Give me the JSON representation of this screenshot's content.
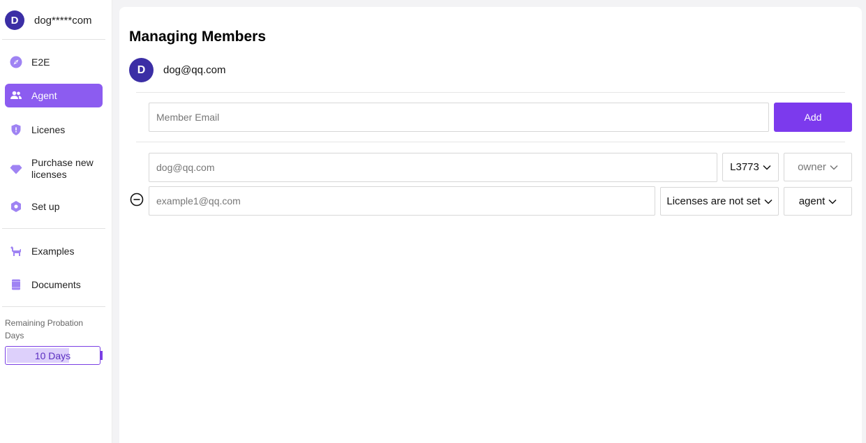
{
  "account": {
    "initial": "D",
    "name": "dog*****com"
  },
  "sidebar": {
    "items": [
      {
        "label": "E2E",
        "icon": "compass-icon",
        "active": false
      },
      {
        "label": "Agent",
        "icon": "users-icon",
        "active": true
      },
      {
        "label": "Licenes",
        "icon": "shield-icon",
        "active": false
      },
      {
        "label": "Purchase new licenses",
        "icon": "diamond-icon",
        "active": false
      },
      {
        "label": "Set up",
        "icon": "settings-hex-icon",
        "active": false
      },
      {
        "label": "Examples",
        "icon": "dog-icon",
        "active": false
      },
      {
        "label": "Documents",
        "icon": "book-icon",
        "active": false
      }
    ],
    "probation": {
      "label": "Remaining Probation Days",
      "value": "10 Days",
      "progress": 0.68
    }
  },
  "main": {
    "title": "Managing Members",
    "owner": {
      "initial": "D",
      "email": "dog@qq.com"
    },
    "add_form": {
      "placeholder": "Member Email",
      "button_label": "Add"
    },
    "members": [
      {
        "email": "dog@qq.com",
        "license": "L3773",
        "role": "owner",
        "removable": false
      },
      {
        "email": "example1@qq.com",
        "license": "Licenses are not set",
        "role": "agent",
        "removable": true
      }
    ]
  },
  "colors": {
    "accent": "#7c3aed",
    "active_nav": "#8c5cf0",
    "avatar": "#3b2ea5",
    "icon": "#8c6cf0"
  }
}
